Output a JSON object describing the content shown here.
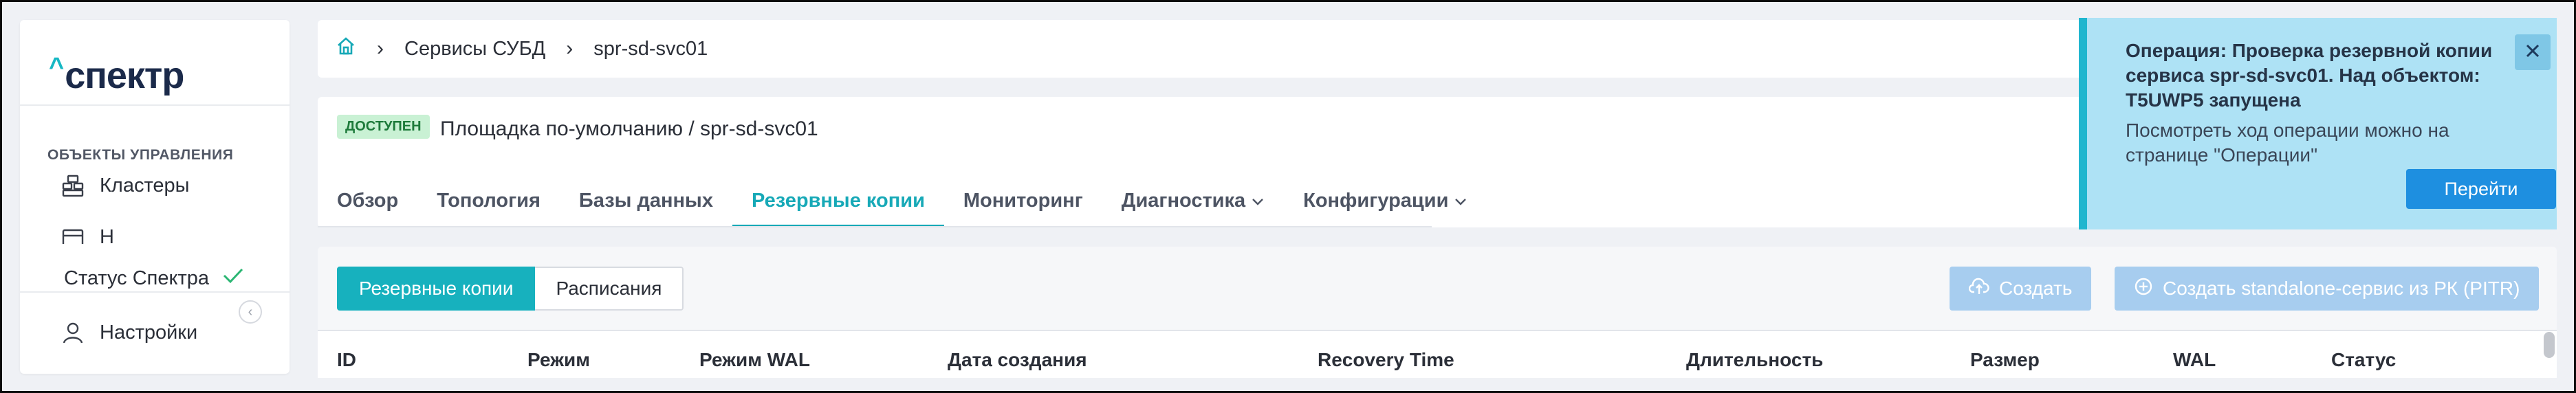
{
  "sidebar": {
    "logo": "спектр",
    "logo_caret": "^",
    "section_title": "ОБЪЕКТЫ УПРАВЛЕНИЯ",
    "items": [
      {
        "label": "Кластеры",
        "icon": "cluster-icon"
      },
      {
        "label": "Н",
        "icon": "nodes-icon"
      }
    ],
    "status_label": "Статус Спектра",
    "settings_label": "Настройки"
  },
  "breadcrumb": {
    "items": [
      "Сервисы СУБД",
      "spr-sd-svc01"
    ]
  },
  "header": {
    "status_badge": "ДОСТУПЕН",
    "path": "Площадка по-умолчанию /  spr-sd-svc01",
    "tabs": [
      {
        "label": "Обзор"
      },
      {
        "label": "Топология"
      },
      {
        "label": "Базы данных"
      },
      {
        "label": "Резервные копии",
        "active": true
      },
      {
        "label": "Мониторинг"
      },
      {
        "label": "Диагностика",
        "dropdown": true
      },
      {
        "label": "Конфигурации",
        "dropdown": true
      }
    ]
  },
  "panel": {
    "segments": [
      "Резервные копии",
      "Расписания"
    ],
    "create_label": "Создать",
    "create_standalone_label": "Создать standalone-сервис из РК (PITR)",
    "columns": [
      "ID",
      "Режим",
      "Режим WAL",
      "Дата создания",
      "Recovery Time",
      "Длительность",
      "Размер",
      "WAL",
      "Статус"
    ]
  },
  "toast": {
    "title": "Операция: Проверка резервной копии сервиса spr-sd-svc01. Над объектом: T5UWP5 запущена",
    "text": "Посмотреть ход операции можно на странице \"Операции\"",
    "button_label": "Перейти"
  },
  "colors": {
    "accent": "#17b1be",
    "badge_bg": "#c9f1d4",
    "toast_bg": "#aee2f5",
    "toast_button": "#1e8fe0",
    "disabled_button": "#a7cdef"
  }
}
